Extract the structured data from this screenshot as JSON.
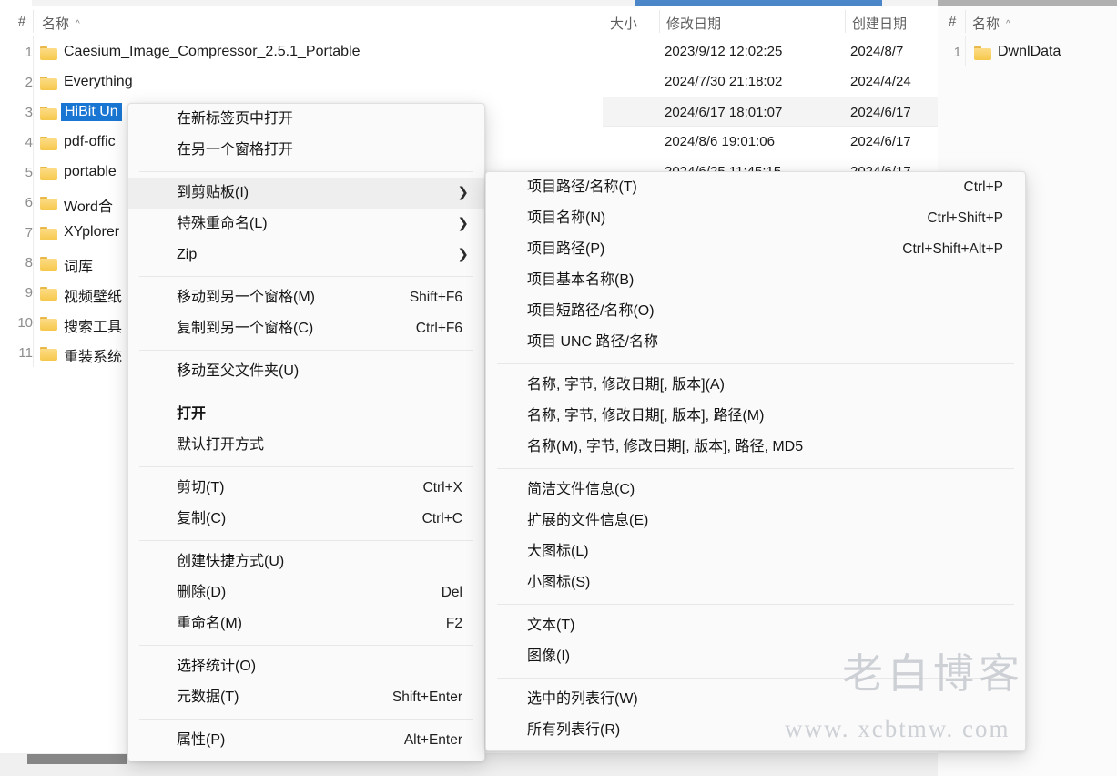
{
  "left_pane": {
    "headers": {
      "index": "#",
      "name": "名称",
      "sort_caret": "^"
    },
    "rows": [
      {
        "num": "1",
        "name": "Caesium_Image_Compressor_2.5.1_Portable",
        "icon": "folder-icon",
        "selected": false
      },
      {
        "num": "2",
        "name": "Everything",
        "icon": "folder-icon",
        "selected": false
      },
      {
        "num": "3",
        "name": "HiBit Un",
        "icon": "folder-icon",
        "selected": true
      },
      {
        "num": "4",
        "name": "pdf-offic",
        "icon": "folder-icon",
        "selected": false
      },
      {
        "num": "5",
        "name": "portable",
        "icon": "folder-icon",
        "selected": false
      },
      {
        "num": "6",
        "name": "Word合",
        "icon": "folder-icon",
        "selected": false
      },
      {
        "num": "7",
        "name": "XYplorer",
        "icon": "folder-icon",
        "selected": false
      },
      {
        "num": "8",
        "name": "词库",
        "icon": "folder-icon",
        "selected": false
      },
      {
        "num": "9",
        "name": "视频壁纸",
        "icon": "folder-icon",
        "selected": false
      },
      {
        "num": "10",
        "name": "搜索工具",
        "icon": "folder-icon",
        "selected": false
      },
      {
        "num": "11",
        "name": "重装系统",
        "icon": "folder-icon",
        "selected": false
      }
    ]
  },
  "mid_pane": {
    "headers": {
      "size": "大小",
      "modified": "修改日期",
      "created": "创建日期"
    },
    "rows": [
      {
        "size": "",
        "modified": "2023/9/12 12:02:25",
        "created": "2024/8/7",
        "highlight": false
      },
      {
        "size": "",
        "modified": "2024/7/30 21:18:02",
        "created": "2024/4/24",
        "highlight": false
      },
      {
        "size": "",
        "modified": "2024/6/17 18:01:07",
        "created": "2024/6/17",
        "highlight": true
      },
      {
        "size": "",
        "modified": "2024/8/6 19:01:06",
        "created": "2024/6/17",
        "highlight": false
      },
      {
        "size": "",
        "modified": "2024/6/25 11:45:15",
        "created": "2024/6/17",
        "highlight": false
      }
    ]
  },
  "right_pane": {
    "headers": {
      "index": "#",
      "name": "名称",
      "sort_caret": "^"
    },
    "rows": [
      {
        "num": "1",
        "name": "DwnlData",
        "icon": "folder-icon"
      }
    ]
  },
  "context_menu": {
    "groups": [
      {
        "items": [
          {
            "label": "在新标签页中打开",
            "accel": "",
            "submenu": false,
            "bold": false,
            "hover": false
          },
          {
            "label": "在另一个窗格打开",
            "accel": "",
            "submenu": false,
            "bold": false,
            "hover": false
          }
        ]
      },
      {
        "items": [
          {
            "label": "到剪贴板(I)",
            "accel": "",
            "submenu": true,
            "bold": false,
            "hover": true
          },
          {
            "label": "特殊重命名(L)",
            "accel": "",
            "submenu": true,
            "bold": false,
            "hover": false
          },
          {
            "label": "Zip",
            "accel": "",
            "submenu": true,
            "bold": false,
            "hover": false
          }
        ]
      },
      {
        "items": [
          {
            "label": "移动到另一个窗格(M)",
            "accel": "Shift+F6",
            "submenu": false,
            "bold": false,
            "hover": false
          },
          {
            "label": "复制到另一个窗格(C)",
            "accel": "Ctrl+F6",
            "submenu": false,
            "bold": false,
            "hover": false
          }
        ]
      },
      {
        "items": [
          {
            "label": "移动至父文件夹(U)",
            "accel": "",
            "submenu": false,
            "bold": false,
            "hover": false
          }
        ]
      },
      {
        "items": [
          {
            "label": "打开",
            "accel": "",
            "submenu": false,
            "bold": true,
            "hover": false
          },
          {
            "label": "默认打开方式",
            "accel": "",
            "submenu": false,
            "bold": false,
            "hover": false
          }
        ]
      },
      {
        "items": [
          {
            "label": "剪切(T)",
            "accel": "Ctrl+X",
            "submenu": false,
            "bold": false,
            "hover": false
          },
          {
            "label": "复制(C)",
            "accel": "Ctrl+C",
            "submenu": false,
            "bold": false,
            "hover": false
          }
        ]
      },
      {
        "items": [
          {
            "label": "创建快捷方式(U)",
            "accel": "",
            "submenu": false,
            "bold": false,
            "hover": false
          },
          {
            "label": "删除(D)",
            "accel": "Del",
            "submenu": false,
            "bold": false,
            "hover": false
          },
          {
            "label": "重命名(M)",
            "accel": "F2",
            "submenu": false,
            "bold": false,
            "hover": false
          }
        ]
      },
      {
        "items": [
          {
            "label": "选择统计(O)",
            "accel": "",
            "submenu": false,
            "bold": false,
            "hover": false
          },
          {
            "label": "元数据(T)",
            "accel": "Shift+Enter",
            "submenu": false,
            "bold": false,
            "hover": false
          }
        ]
      },
      {
        "items": [
          {
            "label": "属性(P)",
            "accel": "Alt+Enter",
            "submenu": false,
            "bold": false,
            "hover": false
          }
        ]
      }
    ]
  },
  "submenu": {
    "groups": [
      {
        "items": [
          {
            "label": "项目路径/名称(T)",
            "accel": "Ctrl+P"
          },
          {
            "label": "项目名称(N)",
            "accel": "Ctrl+Shift+P"
          },
          {
            "label": "项目路径(P)",
            "accel": "Ctrl+Shift+Alt+P"
          },
          {
            "label": "项目基本名称(B)",
            "accel": ""
          },
          {
            "label": "项目短路径/名称(O)",
            "accel": ""
          },
          {
            "label": "项目 UNC 路径/名称",
            "accel": ""
          }
        ]
      },
      {
        "items": [
          {
            "label": "名称, 字节, 修改日期[, 版本](A)",
            "accel": ""
          },
          {
            "label": "名称, 字节, 修改日期[, 版本], 路径(M)",
            "accel": ""
          },
          {
            "label": "名称(M), 字节, 修改日期[, 版本], 路径, MD5",
            "accel": ""
          }
        ]
      },
      {
        "items": [
          {
            "label": "简洁文件信息(C)",
            "accel": ""
          },
          {
            "label": "扩展的文件信息(E)",
            "accel": ""
          },
          {
            "label": "大图标(L)",
            "accel": ""
          },
          {
            "label": "小图标(S)",
            "accel": ""
          }
        ]
      },
      {
        "items": [
          {
            "label": "文本(T)",
            "accel": ""
          },
          {
            "label": "图像(I)",
            "accel": ""
          }
        ]
      },
      {
        "items": [
          {
            "label": "选中的列表行(W)",
            "accel": ""
          },
          {
            "label": "所有列表行(R)",
            "accel": ""
          }
        ]
      }
    ]
  },
  "watermark": {
    "line1": "老白博客",
    "line2": "www. xcbtmw. com"
  },
  "colors": {
    "selection_blue": "#1976d2",
    "header_strip_blue": "#4a86c8",
    "folder_yellow": "#f6c84c",
    "row_highlight": "#f4f4f4",
    "menu_bg": "#fafafa",
    "menu_hover": "#eeeeee"
  }
}
